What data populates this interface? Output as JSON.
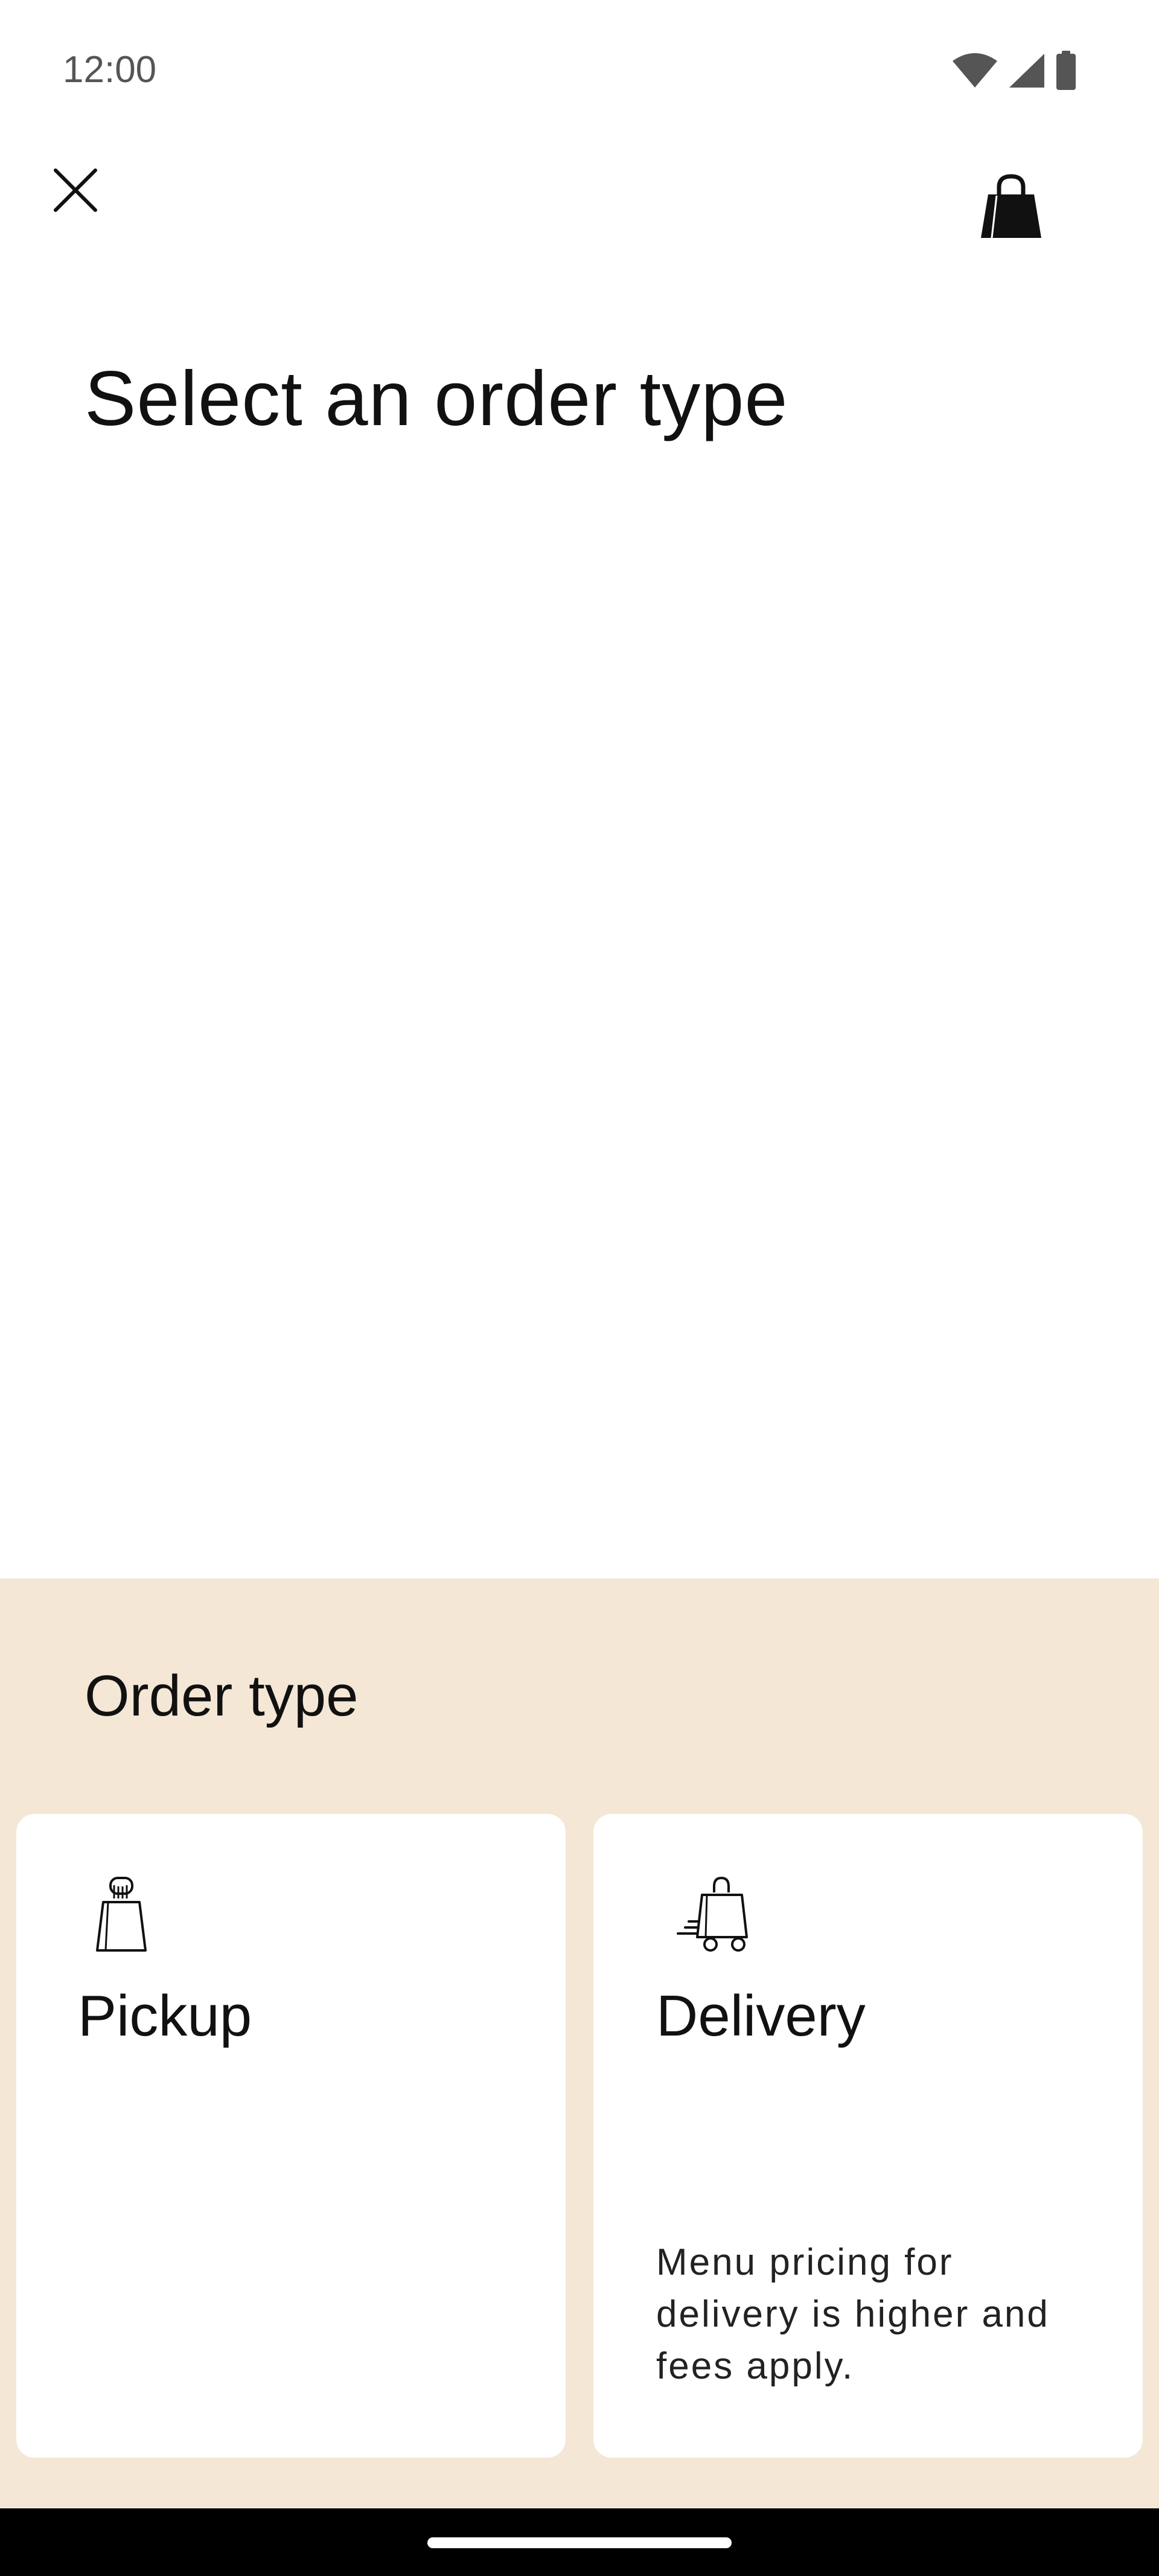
{
  "status_bar": {
    "time": "12:00",
    "icons": [
      "wifi-icon",
      "cellular-signal-icon",
      "battery-icon"
    ]
  },
  "top_bar": {
    "close_icon": "close-icon",
    "bag_icon": "shopping-bag-icon"
  },
  "page": {
    "title": "Select an order type"
  },
  "sheet": {
    "title": "Order type",
    "background_color": "#f4e7d5",
    "options": [
      {
        "label": "Pickup",
        "icon": "pickup-bag-icon",
        "note": ""
      },
      {
        "label": "Delivery",
        "icon": "delivery-cart-icon",
        "note": "Menu pricing for delivery is higher and fees apply."
      }
    ]
  }
}
